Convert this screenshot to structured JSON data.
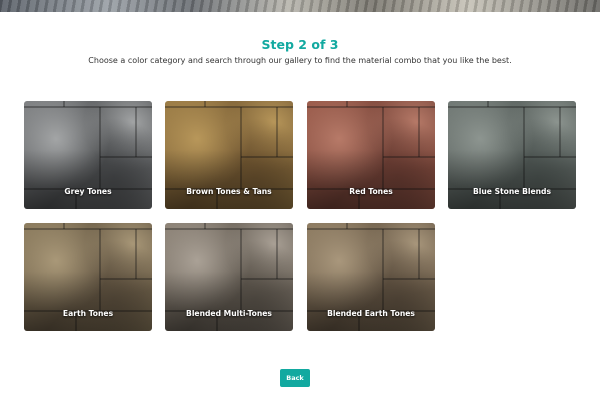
{
  "header": {
    "step_title": "Step 2 of 3",
    "instructions": "Choose a color category and search through our gallery to find the material combo that you like the best."
  },
  "categories": [
    {
      "label": "Grey Tones",
      "colors": [
        "#7c7e80",
        "#4a4c4e",
        "#a3a5a6"
      ]
    },
    {
      "label": "Brown Tones & Tans",
      "colors": [
        "#9a7b45",
        "#6e5430",
        "#b8975a"
      ]
    },
    {
      "label": "Red Tones",
      "colors": [
        "#9a5a4a",
        "#6c3e34",
        "#b77a68"
      ]
    },
    {
      "label": "Blue Stone Blends",
      "colors": [
        "#6f7773",
        "#4d5552",
        "#8d9590"
      ]
    },
    {
      "label": "Earth Tones",
      "colors": [
        "#8a7a5c",
        "#5f5240",
        "#a99878"
      ]
    },
    {
      "label": "Blended Multi-Tones",
      "colors": [
        "#8b8175",
        "#5d564d",
        "#aaa196"
      ]
    },
    {
      "label": "Blended Earth Tones",
      "colors": [
        "#8c7a60",
        "#5e5040",
        "#a9977c"
      ]
    }
  ],
  "actions": {
    "back_label": "Back"
  },
  "theme": {
    "accent": "#12a9a0",
    "text": "#333333"
  }
}
